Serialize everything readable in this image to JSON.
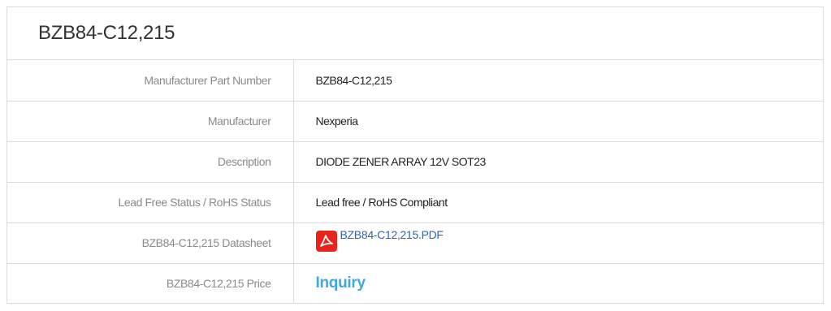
{
  "product": {
    "title": "BZB84-C12,215"
  },
  "specs": {
    "rows": [
      {
        "label": "Manufacturer Part Number",
        "value": "BZB84-C12,215"
      },
      {
        "label": "Manufacturer",
        "value": "Nexperia"
      },
      {
        "label": "Description",
        "value": "DIODE ZENER ARRAY 12V SOT23"
      },
      {
        "label": "Lead Free Status / RoHS Status",
        "value": "Lead free / RoHS Compliant"
      },
      {
        "label": "BZB84-C12,215 Datasheet",
        "value": "BZB84-C12,215.PDF",
        "icon": "pdf-icon"
      },
      {
        "label": "BZB84-C12,215 Price",
        "value": "Inquiry"
      }
    ]
  },
  "colors": {
    "link": "#2a66b8",
    "inquiry": "#3fa9d9",
    "pdf_icon": "#e8231c",
    "border": "#dcdcdc",
    "label_text": "#8a8a8a"
  }
}
